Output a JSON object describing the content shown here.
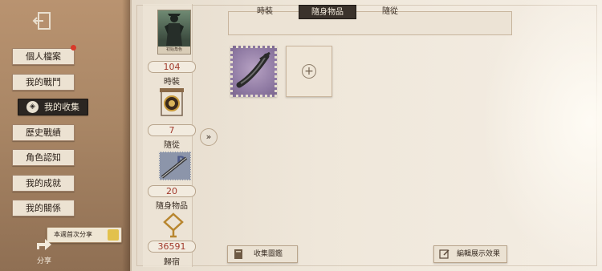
{
  "nav": {
    "items": [
      {
        "label": "個人檔案",
        "has_notification": true
      },
      {
        "label": "我的戰鬥"
      },
      {
        "label": "我的收集",
        "active": true
      },
      {
        "label": "歷史戰績"
      },
      {
        "label": "角色認知"
      },
      {
        "label": "我的成就"
      },
      {
        "label": "我的關係"
      }
    ],
    "share_tip": "本週首次分享",
    "share_label": "分享"
  },
  "stats": {
    "portrait_caption": "初始角色",
    "costume": {
      "count": "104",
      "label": "時裝"
    },
    "follower": {
      "count": "7",
      "label": "隨從"
    },
    "accessory": {
      "count": "20",
      "label": "隨身物品"
    },
    "home": {
      "count": "36591",
      "label": "歸宿"
    }
  },
  "tabs": [
    {
      "label": "時裝"
    },
    {
      "label": "隨身物品",
      "active": true
    },
    {
      "label": "隨從"
    }
  ],
  "buttons": {
    "collection_guide": "收集圖鑑",
    "edit_display": "編輯展示效果"
  },
  "colors": {
    "accent_red": "#a13a2c",
    "active_dark": "#2b2622",
    "panel_bg": "#efe7da"
  }
}
